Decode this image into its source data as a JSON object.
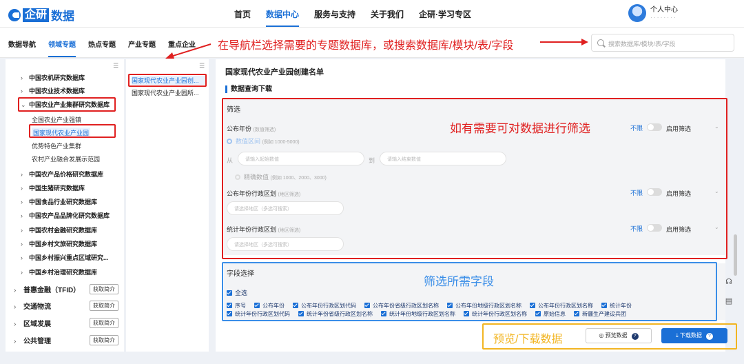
{
  "header": {
    "logo_box": "企研",
    "logo_text": "数据",
    "nav": [
      "首页",
      "数据中心",
      "服务与支持",
      "关于我们",
      "企研·学习专区"
    ],
    "active_nav": "数据中心",
    "user_label": "个人中心",
    "user_sub": "· · · · ·  · · ·"
  },
  "subnav": {
    "tabs": [
      "数据导航",
      "领域专题",
      "热点专题",
      "产业专题",
      "重点企业"
    ],
    "active_tab": "领域专题",
    "search_placeholder": "搜索数据库/模块/表/字段"
  },
  "annotations": {
    "nav_hint": "在导航栏选择需要的专题数据库，或搜索数据库/模块/表/字段",
    "filter_hint": "如有需要可对数据进行筛选",
    "field_hint": "筛选所需字段",
    "download_hint": "预览/下载数据"
  },
  "left_tree": {
    "items": [
      {
        "label": "中国农机研究数据库"
      },
      {
        "label": "中国农业技术数据库"
      },
      {
        "label": "中国农业产业集群研究数据库",
        "expanded": true
      },
      {
        "label": "中国农产品价格研究数据库"
      },
      {
        "label": "中国生猪研究数据库"
      },
      {
        "label": "中国食品行业研究数据库"
      },
      {
        "label": "中国农产品品牌化研究数据库"
      },
      {
        "label": "中国农村金融研究数据库"
      },
      {
        "label": "中国乡村文旅研究数据库"
      },
      {
        "label": "中国乡村振兴重点区域研究..."
      },
      {
        "label": "中国乡村治理研究数据库"
      }
    ],
    "sub_items": [
      "全国农业产业强镇",
      "国家现代农业产业园",
      "优势特色产业集群",
      "农村产业融合发展示范园"
    ],
    "selected_sub": "国家现代农业产业园",
    "categories": [
      "普惠金融（TFID）",
      "交通物流",
      "区域发展",
      "公共管理"
    ],
    "intro_button": "获取简介"
  },
  "mid_list": {
    "items": [
      "国家现代农业产业园创...",
      "国家现代农业产业园所..."
    ]
  },
  "main": {
    "title": "国家现代农业产业园创建名单",
    "section_title": "数据查询下载",
    "filter": {
      "title": "筛选",
      "rows": [
        {
          "label": "公布年份",
          "hint": "(数值筛选)",
          "status": "不限",
          "enable": "启用筛选"
        },
        {
          "label": "公布年份行政区划",
          "hint": "(地区筛选)",
          "status": "不限",
          "enable": "启用筛选"
        },
        {
          "label": "统计年份行政区划",
          "hint": "(地区筛选)",
          "status": "不限",
          "enable": "启用筛选"
        }
      ],
      "range_label": "数值区间",
      "range_example": "(例如 1000-5000)",
      "from": "从",
      "to": "到",
      "from_placeholder": "请输入起始数值",
      "to_placeholder": "请输入结束数值",
      "exact_label": "精确数值",
      "exact_example": "(例如 1000、2000、3000)",
      "region_placeholder": "请选择地区（多选可搜索）"
    },
    "fields": {
      "title": "字段选择",
      "select_all": "全选",
      "row1": [
        "序号",
        "公布年份",
        "公布年份行政区划代码",
        "公布年份省级行政区划名称",
        "公布年份地级行政区划名称",
        "公布年份行政区划名称",
        "统计年份"
      ],
      "row2": [
        "统计年份行政区划代码",
        "统计年份省级行政区划名称",
        "统计年份地级行政区划名称",
        "统计年份行政区划名称",
        "原始信息",
        "新疆生产建设兵团"
      ]
    },
    "preview_button": "预览数据",
    "download_button": "下载数据"
  }
}
